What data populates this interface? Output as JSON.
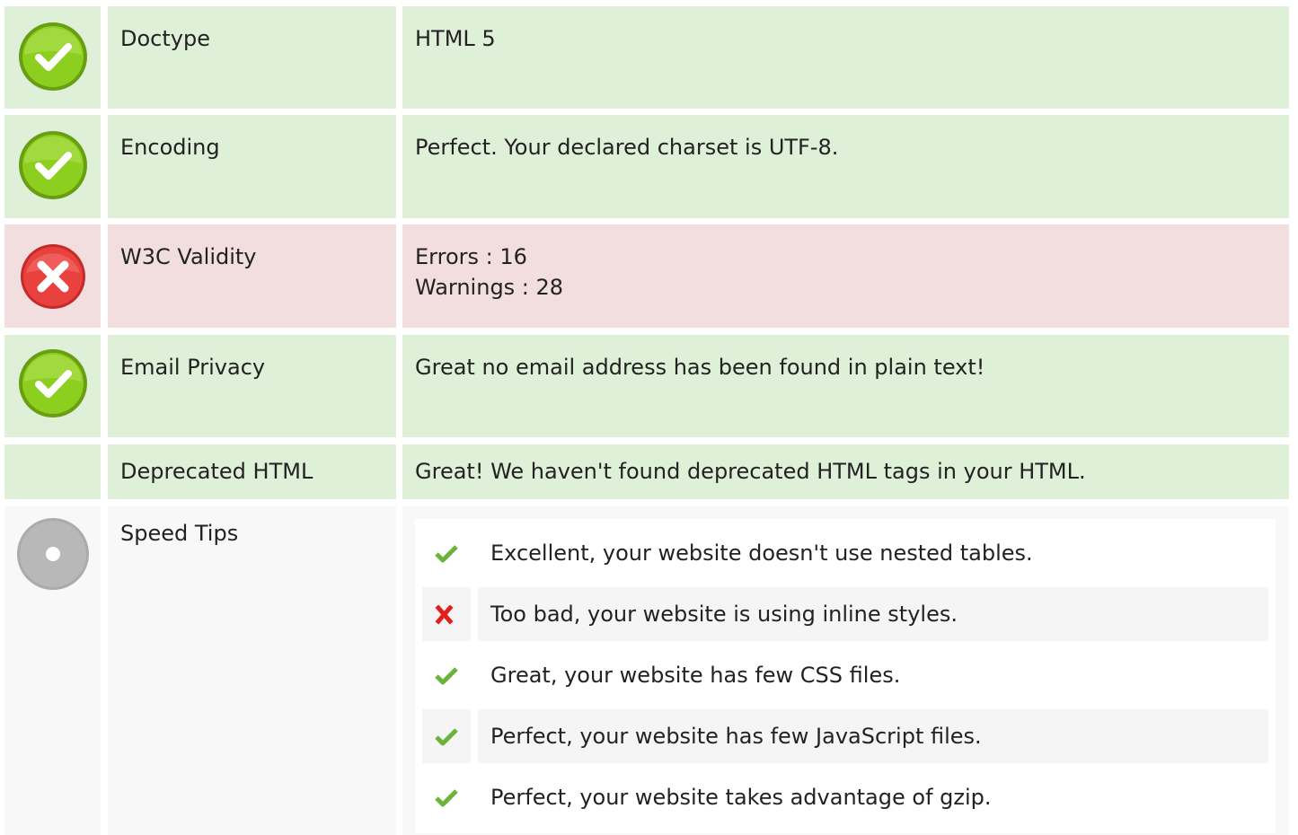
{
  "rows": [
    {
      "label": "Doctype",
      "status": "pass",
      "icon": "check-circle-icon",
      "lines": [
        "HTML 5"
      ]
    },
    {
      "label": "Encoding",
      "status": "pass",
      "icon": "check-circle-icon",
      "lines": [
        "Perfect. Your declared charset is UTF-8."
      ]
    },
    {
      "label": "W3C Validity",
      "status": "fail",
      "icon": "x-circle-icon",
      "lines": [
        "Errors : 16",
        "Warnings : 28"
      ]
    },
    {
      "label": "Email Privacy",
      "status": "pass",
      "icon": "check-circle-icon",
      "lines": [
        "Great no email address has been found in plain text!"
      ]
    },
    {
      "label": "Deprecated HTML",
      "status": "pass",
      "icon": "",
      "lines": [
        "Great! We haven't found deprecated HTML tags in your HTML."
      ]
    }
  ],
  "speed": {
    "label": "Speed Tips",
    "icon": "neutral-circle-icon",
    "tips": [
      {
        "text": "Excellent, your website doesn't use nested tables.",
        "status": "pass",
        "icon": "checkmark-icon"
      },
      {
        "text": "Too bad, your website is using inline styles.",
        "status": "fail",
        "icon": "cross-icon"
      },
      {
        "text": "Great, your website has few CSS files.",
        "status": "pass",
        "icon": "checkmark-icon"
      },
      {
        "text": "Perfect, your website has few JavaScript files.",
        "status": "pass",
        "icon": "checkmark-icon"
      },
      {
        "text": "Perfect, your website takes advantage of gzip.",
        "status": "pass",
        "icon": "checkmark-icon"
      }
    ]
  },
  "colors": {
    "pass_bg": "#dff0d8",
    "fail_bg": "#f2dede",
    "neutral_bg": "#f8f8f8",
    "pass_icon": "#7ec21c",
    "fail_icon": "#e03a3a",
    "neutral_icon": "#b0b0b0"
  }
}
